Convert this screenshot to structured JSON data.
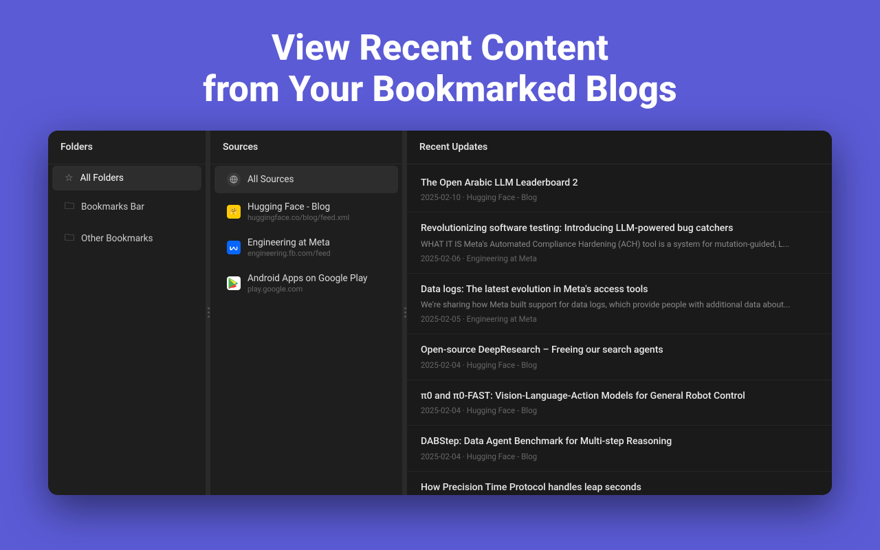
{
  "hero": {
    "line1": "View Recent Content",
    "line2": "from Your Bookmarked Blogs"
  },
  "folders": {
    "panel_title": "Folders",
    "items": [
      {
        "id": "all-folders",
        "label": "All Folders",
        "icon": "star",
        "active": true
      },
      {
        "id": "bookmarks-bar",
        "label": "Bookmarks Bar",
        "icon": "folder",
        "active": false
      },
      {
        "id": "other-bookmarks",
        "label": "Other Bookmarks",
        "icon": "folder",
        "active": false
      }
    ]
  },
  "sources": {
    "panel_title": "Sources",
    "items": [
      {
        "id": "all-sources",
        "label": "All Sources",
        "icon": "globe",
        "url": "",
        "active": true
      },
      {
        "id": "huggingface",
        "label": "Hugging Face - Blog",
        "url": "huggingface.co/blog/feed.xml",
        "icon": "hf",
        "active": false
      },
      {
        "id": "engineering-meta",
        "label": "Engineering at Meta",
        "url": "engineering.fb.com/feed",
        "icon": "meta",
        "active": false
      },
      {
        "id": "google-play",
        "label": "Android Apps on Google Play",
        "url": "play.google.com",
        "icon": "gplay",
        "active": false
      }
    ]
  },
  "updates": {
    "panel_title": "Recent Updates",
    "items": [
      {
        "id": "item1",
        "title": "The Open Arabic LLM Leaderboard 2",
        "excerpt": "",
        "date": "2025-02-10",
        "source": "Hugging Face - Blog"
      },
      {
        "id": "item2",
        "title": "Revolutionizing software testing: Introducing LLM-powered bug catchers",
        "excerpt": "WHAT IT IS Meta's Automated Compliance Hardening (ACH) tool is a system for mutation-guided, L...",
        "date": "2025-02-06",
        "source": "Engineering at Meta"
      },
      {
        "id": "item3",
        "title": "Data logs: The latest evolution in Meta's access tools",
        "excerpt": "We're sharing how Meta built support for data logs, which provide people with additional data about...",
        "date": "2025-02-05",
        "source": "Engineering at Meta"
      },
      {
        "id": "item4",
        "title": "Open-source DeepResearch – Freeing our search agents",
        "excerpt": "",
        "date": "2025-02-04",
        "source": "Hugging Face - Blog"
      },
      {
        "id": "item5",
        "title": "π0 and π0-FAST: Vision-Language-Action Models for General Robot Control",
        "excerpt": "",
        "date": "2025-02-04",
        "source": "Hugging Face - Blog"
      },
      {
        "id": "item6",
        "title": "DABStep: Data Agent Benchmark for Multi-step Reasoning",
        "excerpt": "",
        "date": "2025-02-04",
        "source": "Hugging Face - Blog"
      },
      {
        "id": "item7",
        "title": "How Precision Time Protocol handles leap seconds",
        "excerpt": "",
        "date": "",
        "source": ""
      }
    ]
  }
}
